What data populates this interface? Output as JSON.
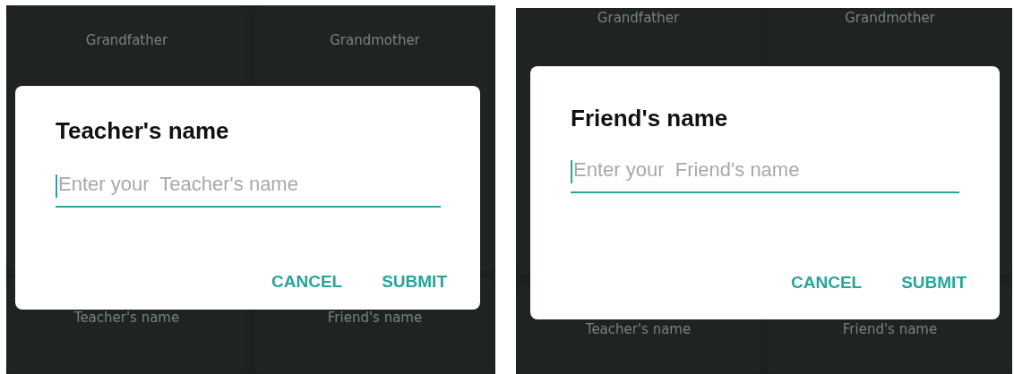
{
  "panels": [
    {
      "background_tiles": [
        {
          "label": "Grandfather"
        },
        {
          "label": "Grandmother"
        },
        {
          "label": "Teacher's name"
        },
        {
          "label": "Friend's name"
        }
      ],
      "dialog": {
        "title": "Teacher's name",
        "field": {
          "placeholder": "Enter your  Teacher's name"
        },
        "buttons": [
          "CANCEL",
          "SUBMIT"
        ]
      }
    },
    {
      "background_tiles": [
        {
          "label": "Grandfather"
        },
        {
          "label": "Grandmother"
        },
        {
          "label": "Teacher's name"
        },
        {
          "label": "Friend's name"
        }
      ],
      "dialog": {
        "title": "Friend's name",
        "field": {
          "placeholder": "Enter your  Friend's name"
        },
        "buttons": [
          "CANCEL",
          "SUBMIT"
        ]
      }
    }
  ]
}
